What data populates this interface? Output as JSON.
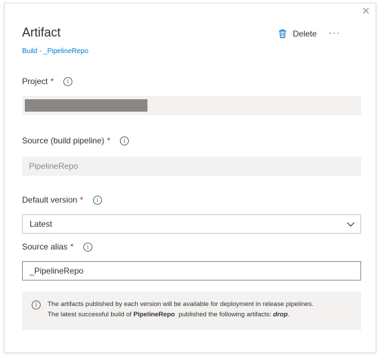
{
  "panel": {
    "title": "Artifact",
    "subtitle": "Build - _PipelineRepo",
    "delete_label": "Delete",
    "more_label": "···",
    "close_label": "✕"
  },
  "fields": {
    "project": {
      "label": "Project",
      "required": "*",
      "value_redacted": true
    },
    "source": {
      "label": "Source (build pipeline)",
      "required": "*",
      "value": "PipelineRepo"
    },
    "default_version": {
      "label": "Default version",
      "required": "*",
      "value": "Latest"
    },
    "source_alias": {
      "label": "Source alias",
      "required": "*",
      "value": "_PipelineRepo"
    }
  },
  "info_glyph": "i",
  "note": {
    "line1": "The artifacts published by each version will be available for deployment in release pipelines.",
    "line2_prefix": "The latest successful build of ",
    "line2_pipeline": "PipelineRepo",
    "line2_middle": "  published the following artifacts: ",
    "line2_artifact": "drop",
    "line2_suffix": "."
  },
  "colors": {
    "accent": "#0078d4",
    "required": "#a4262c",
    "disabled_bg": "#f3f2f1"
  }
}
